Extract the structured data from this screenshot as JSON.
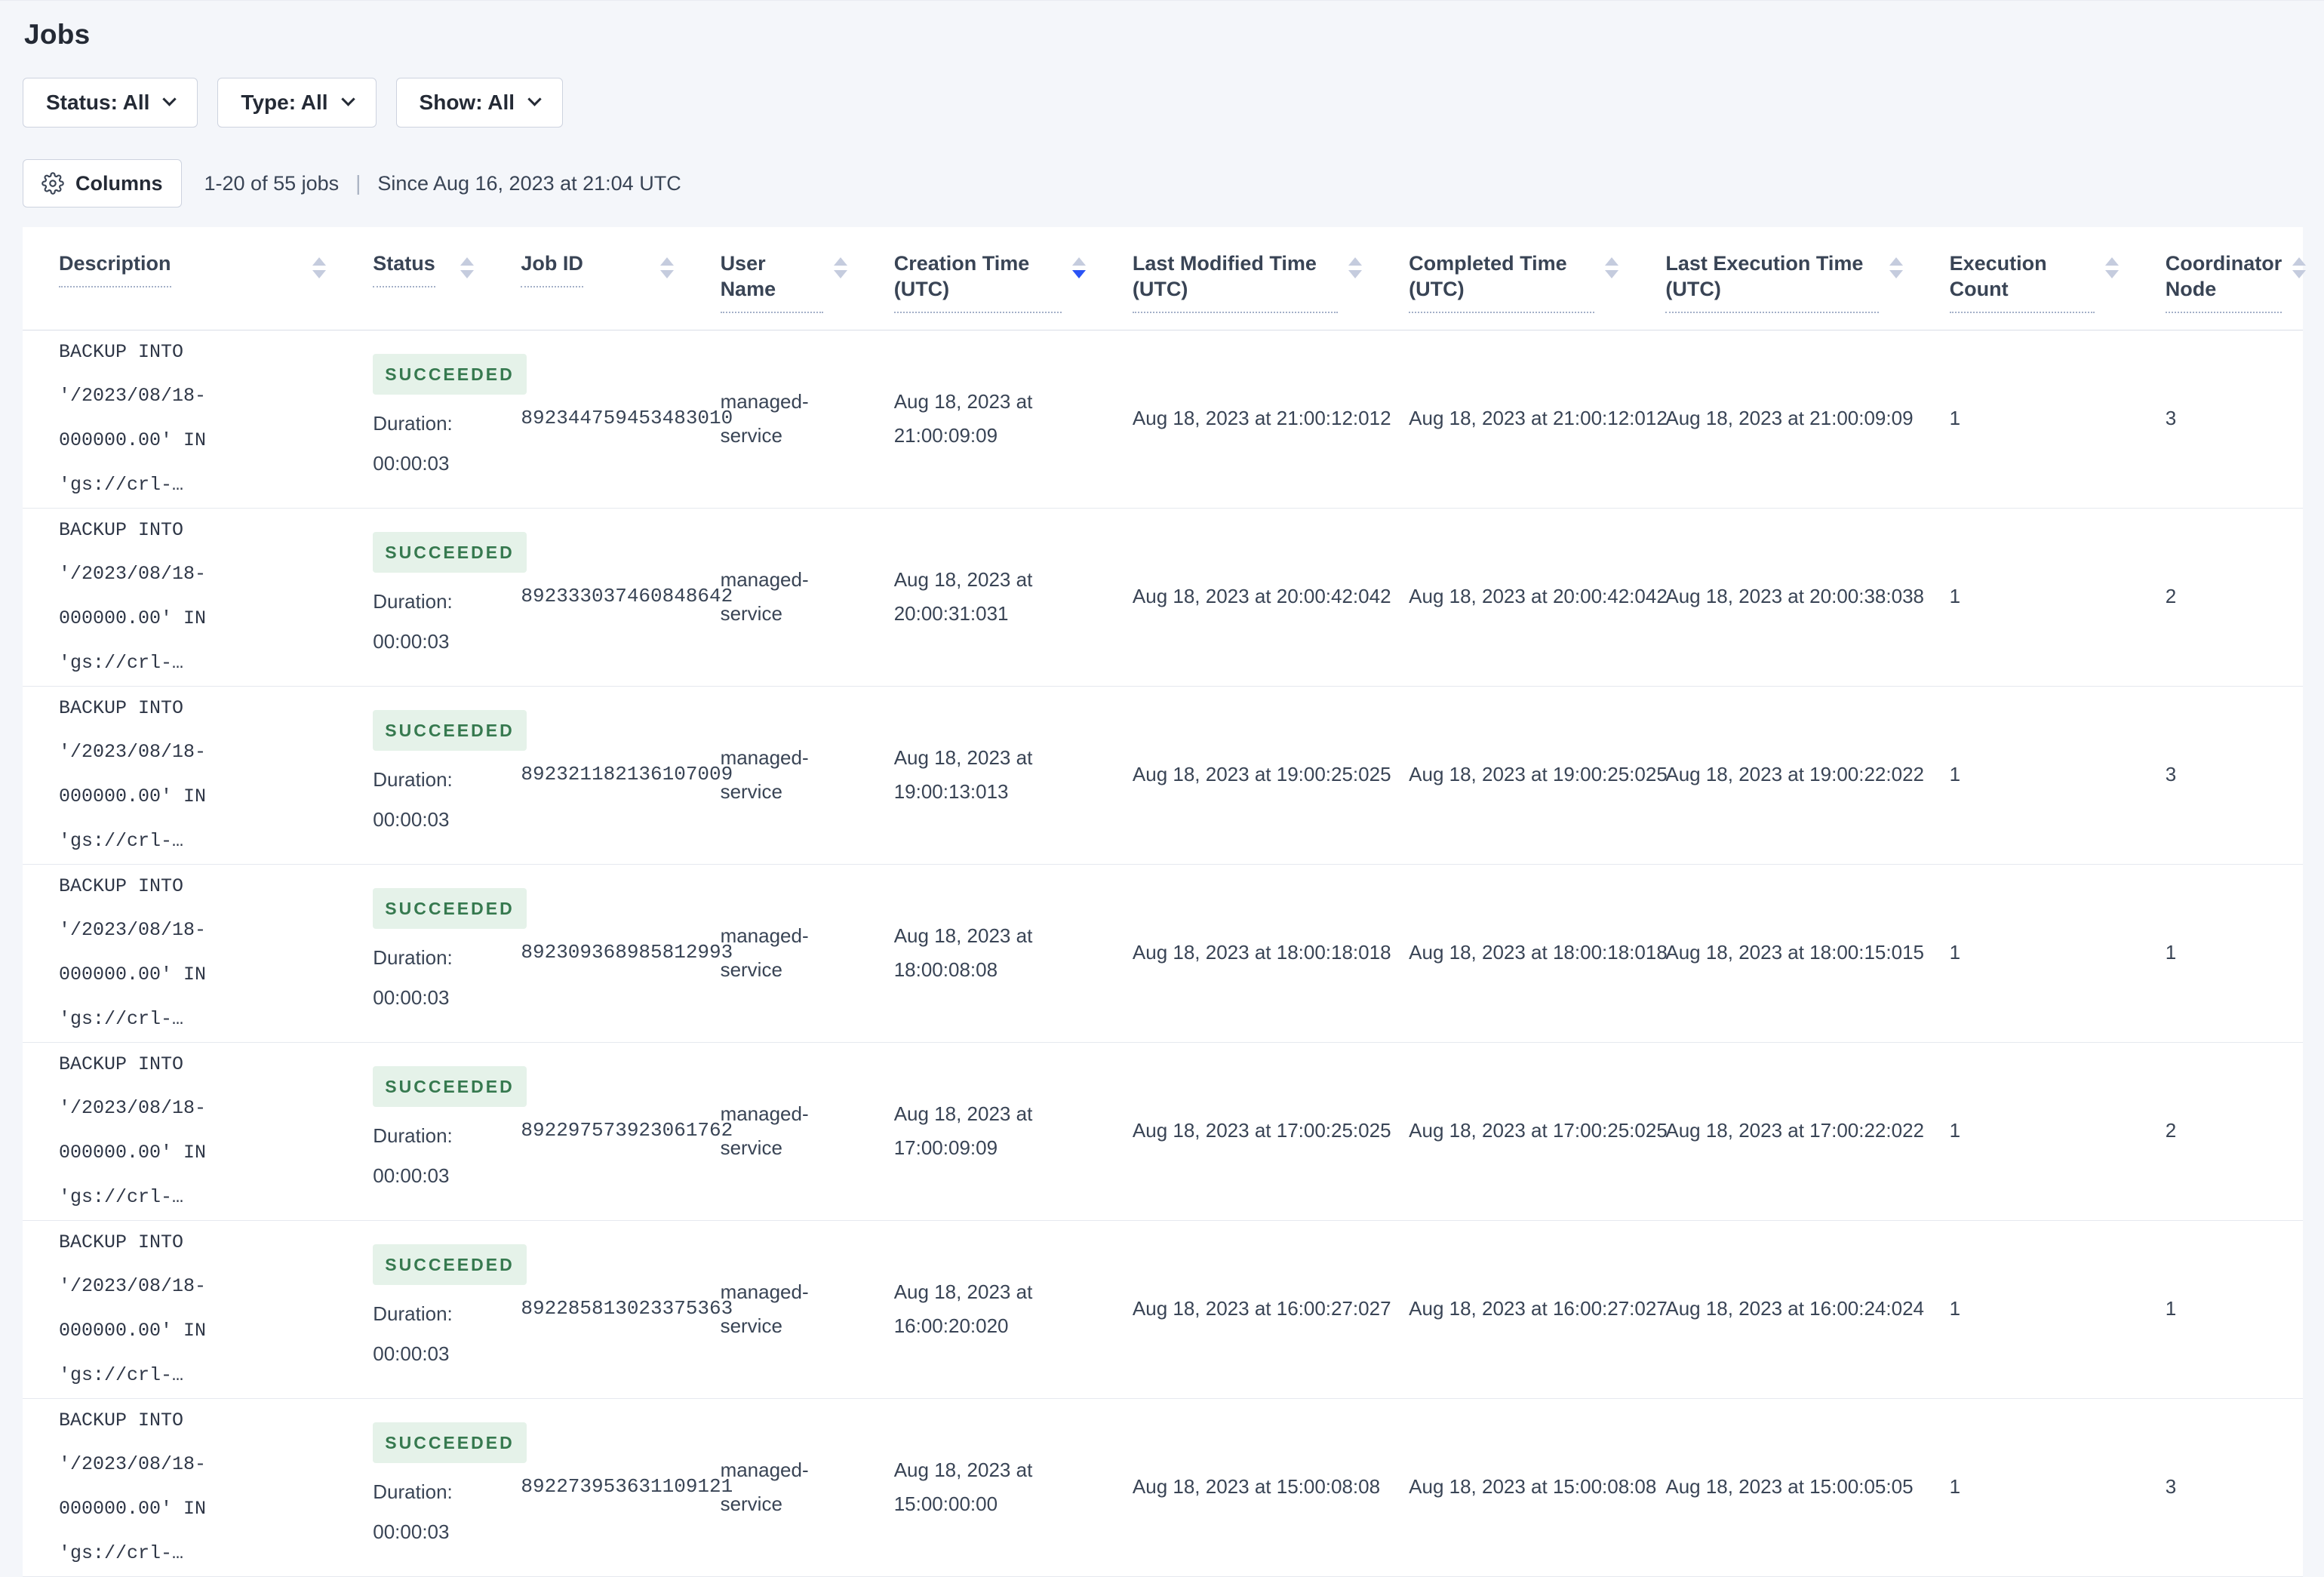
{
  "page": {
    "title": "Jobs"
  },
  "filters": {
    "status": {
      "label": "Status: All"
    },
    "type": {
      "label": "Type: All"
    },
    "show": {
      "label": "Show: All"
    }
  },
  "toolbar": {
    "columns_button_label": "Columns",
    "results_count": "1-20 of 55 jobs",
    "divider": "|",
    "since_text": "Since Aug 16, 2023 at 21:04 UTC"
  },
  "icons": {
    "gear": "cog-outline-svg",
    "chevron_down": "css-chevron-shape",
    "sort_arrows": "css-up-down-triangles"
  },
  "colors": {
    "page_background": "#F4F6FA",
    "accent_sort_blue": "#2A53F5",
    "success_badge_bg": "#E5F2E9",
    "success_badge_text": "#36794F",
    "text_primary": "#242A35",
    "text_body": "#394455",
    "row_border": "#E6E9EF"
  },
  "table": {
    "columns": [
      {
        "label": "Description"
      },
      {
        "label": "Status"
      },
      {
        "label": "Job ID"
      },
      {
        "label": "User Name"
      },
      {
        "label": "Creation Time (UTC)",
        "sort": "desc"
      },
      {
        "label": "Last Modified Time (UTC)"
      },
      {
        "label": "Completed Time (UTC)"
      },
      {
        "label": "Last Execution Time (UTC)"
      },
      {
        "label": "Execution Count"
      },
      {
        "label": "Coordinator Node"
      }
    ],
    "rows": [
      {
        "description": "BACKUP INTO '/2023/08/18-\n000000.00' IN 'gs://crl-…",
        "status": "SUCCEEDED",
        "duration_label": "Duration:",
        "duration": "00:00:03",
        "job_id": "892344759453483010",
        "user_name": "managed-service",
        "creation_time": "Aug 18, 2023 at\n21:00:09:09",
        "last_modified_time": "Aug 18, 2023 at 21:00:12:012",
        "completed_time": "Aug 18, 2023 at 21:00:12:012",
        "last_execution_time": "Aug 18, 2023 at 21:00:09:09",
        "execution_count": "1",
        "coordinator_node": "3"
      },
      {
        "description": "BACKUP INTO '/2023/08/18-\n000000.00' IN 'gs://crl-…",
        "status": "SUCCEEDED",
        "duration_label": "Duration:",
        "duration": "00:00:03",
        "job_id": "892333037460848642",
        "user_name": "managed-service",
        "creation_time": "Aug 18, 2023 at\n20:00:31:031",
        "last_modified_time": "Aug 18, 2023 at 20:00:42:042",
        "completed_time": "Aug 18, 2023 at 20:00:42:042",
        "last_execution_time": "Aug 18, 2023 at 20:00:38:038",
        "execution_count": "1",
        "coordinator_node": "2"
      },
      {
        "description": "BACKUP INTO '/2023/08/18-\n000000.00' IN 'gs://crl-…",
        "status": "SUCCEEDED",
        "duration_label": "Duration:",
        "duration": "00:00:03",
        "job_id": "892321182136107009",
        "user_name": "managed-service",
        "creation_time": "Aug 18, 2023 at\n19:00:13:013",
        "last_modified_time": "Aug 18, 2023 at 19:00:25:025",
        "completed_time": "Aug 18, 2023 at 19:00:25:025",
        "last_execution_time": "Aug 18, 2023 at 19:00:22:022",
        "execution_count": "1",
        "coordinator_node": "3"
      },
      {
        "description": "BACKUP INTO '/2023/08/18-\n000000.00' IN 'gs://crl-…",
        "status": "SUCCEEDED",
        "duration_label": "Duration:",
        "duration": "00:00:03",
        "job_id": "892309368985812993",
        "user_name": "managed-service",
        "creation_time": "Aug 18, 2023 at\n18:00:08:08",
        "last_modified_time": "Aug 18, 2023 at 18:00:18:018",
        "completed_time": "Aug 18, 2023 at 18:00:18:018",
        "last_execution_time": "Aug 18, 2023 at 18:00:15:015",
        "execution_count": "1",
        "coordinator_node": "1"
      },
      {
        "description": "BACKUP INTO '/2023/08/18-\n000000.00' IN 'gs://crl-…",
        "status": "SUCCEEDED",
        "duration_label": "Duration:",
        "duration": "00:00:03",
        "job_id": "892297573923061762",
        "user_name": "managed-service",
        "creation_time": "Aug 18, 2023 at\n17:00:09:09",
        "last_modified_time": "Aug 18, 2023 at 17:00:25:025",
        "completed_time": "Aug 18, 2023 at 17:00:25:025",
        "last_execution_time": "Aug 18, 2023 at 17:00:22:022",
        "execution_count": "1",
        "coordinator_node": "2"
      },
      {
        "description": "BACKUP INTO '/2023/08/18-\n000000.00' IN 'gs://crl-…",
        "status": "SUCCEEDED",
        "duration_label": "Duration:",
        "duration": "00:00:03",
        "job_id": "892285813023375363",
        "user_name": "managed-service",
        "creation_time": "Aug 18, 2023 at\n16:00:20:020",
        "last_modified_time": "Aug 18, 2023 at 16:00:27:027",
        "completed_time": "Aug 18, 2023 at 16:00:27:027",
        "last_execution_time": "Aug 18, 2023 at 16:00:24:024",
        "execution_count": "1",
        "coordinator_node": "1"
      },
      {
        "description": "BACKUP INTO '/2023/08/18-\n000000.00' IN 'gs://crl-…",
        "status": "SUCCEEDED",
        "duration_label": "Duration:",
        "duration": "00:00:03",
        "job_id": "892273953631109121",
        "user_name": "managed-service",
        "creation_time": "Aug 18, 2023 at\n15:00:00:00",
        "last_modified_time": "Aug 18, 2023 at 15:00:08:08",
        "completed_time": "Aug 18, 2023 at 15:00:08:08",
        "last_execution_time": "Aug 18, 2023 at 15:00:05:05",
        "execution_count": "1",
        "coordinator_node": "3"
      }
    ]
  }
}
